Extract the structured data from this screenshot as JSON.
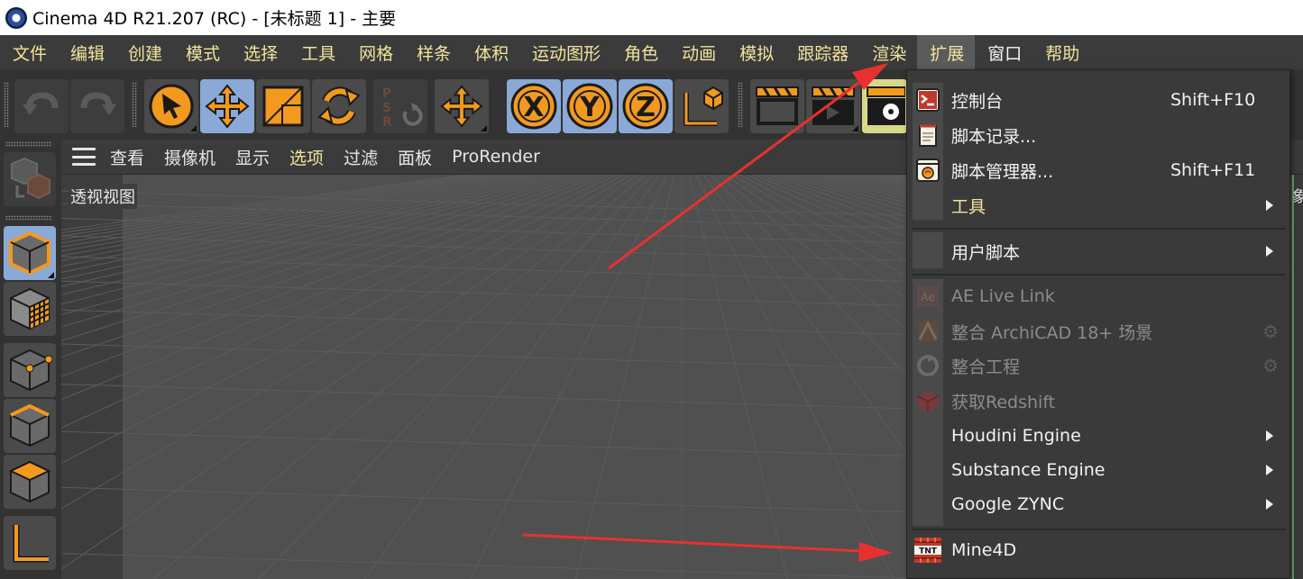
{
  "window": {
    "title": "Cinema 4D R21.207 (RC) - [未标题 1] - 主要"
  },
  "menubar": {
    "items": [
      {
        "label": "文件"
      },
      {
        "label": "编辑"
      },
      {
        "label": "创建"
      },
      {
        "label": "模式"
      },
      {
        "label": "选择"
      },
      {
        "label": "工具"
      },
      {
        "label": "网格"
      },
      {
        "label": "样条"
      },
      {
        "label": "体积"
      },
      {
        "label": "运动图形"
      },
      {
        "label": "角色"
      },
      {
        "label": "动画"
      },
      {
        "label": "模拟"
      },
      {
        "label": "跟踪器"
      },
      {
        "label": "渲染"
      },
      {
        "label": "扩展"
      },
      {
        "label": "窗口"
      },
      {
        "label": "帮助"
      }
    ],
    "active": "扩展"
  },
  "toolbar": {
    "buttons": [
      {
        "name": "undo-icon"
      },
      {
        "name": "redo-icon"
      },
      {
        "name": "live-selection-icon"
      },
      {
        "name": "move-icon"
      },
      {
        "name": "scale-icon"
      },
      {
        "name": "rotate-icon"
      },
      {
        "name": "psr-icon",
        "letters": [
          "P",
          "S",
          "R"
        ]
      },
      {
        "name": "transform-icon"
      },
      {
        "name": "x-axis-lock-icon",
        "text": "X"
      },
      {
        "name": "y-axis-lock-icon",
        "text": "Y"
      },
      {
        "name": "z-axis-lock-icon",
        "text": "Z"
      },
      {
        "name": "world-coordinates-icon"
      },
      {
        "name": "render-view-icon"
      },
      {
        "name": "render-picture-viewer-icon"
      },
      {
        "name": "render-settings-icon"
      }
    ]
  },
  "viewport_menu": {
    "items": [
      {
        "label": "查看"
      },
      {
        "label": "摄像机"
      },
      {
        "label": "显示"
      },
      {
        "label": "选项"
      },
      {
        "label": "过滤"
      },
      {
        "label": "面板"
      },
      {
        "label": "ProRender"
      }
    ],
    "highlighted": "选项"
  },
  "viewport": {
    "label": "透视视图",
    "right_edge_text": "象"
  },
  "left_palette": {
    "buttons": [
      {
        "name": "make-editable-icon"
      },
      {
        "name": "model-mode-icon"
      },
      {
        "name": "texture-mode-icon"
      },
      {
        "name": "point-mode-icon"
      },
      {
        "name": "edge-mode-icon"
      },
      {
        "name": "polygon-mode-icon"
      },
      {
        "name": "axis-mode-icon"
      }
    ]
  },
  "extensions_menu": {
    "items": [
      {
        "label": "控制台",
        "shortcut": "Shift+F10",
        "icon": "console-icon",
        "state": "normal"
      },
      {
        "label": "脚本记录...",
        "shortcut": "",
        "icon": "script-log-icon",
        "state": "normal"
      },
      {
        "label": "脚本管理器...",
        "shortcut": "Shift+F11",
        "icon": "script-manager-icon",
        "state": "normal"
      },
      {
        "label": "工具",
        "shortcut": "",
        "icon": "",
        "state": "submenu-yellow"
      },
      {
        "label": "用户脚本",
        "shortcut": "",
        "icon": "",
        "state": "submenu"
      },
      {
        "label": "AE Live Link",
        "shortcut": "",
        "icon": "ae-icon",
        "state": "disabled"
      },
      {
        "label": "整合 ArchiCAD 18+ 场景",
        "shortcut": "",
        "icon": "archicad-icon",
        "state": "disabled-gear"
      },
      {
        "label": "整合工程",
        "shortcut": "",
        "icon": "merge-project-icon",
        "state": "disabled-gear"
      },
      {
        "label": "获取Redshift",
        "shortcut": "",
        "icon": "redshift-icon",
        "state": "disabled"
      },
      {
        "label": "Houdini Engine",
        "shortcut": "",
        "icon": "",
        "state": "submenu"
      },
      {
        "label": "Substance Engine",
        "shortcut": "",
        "icon": "",
        "state": "submenu"
      },
      {
        "label": "Google ZYNC",
        "shortcut": "",
        "icon": "",
        "state": "submenu"
      },
      {
        "label": "Mine4D",
        "shortcut": "",
        "icon": "tnt-icon",
        "state": "normal",
        "icon_text": "TNT"
      }
    ]
  },
  "colors": {
    "menu_text": "#f2e39d",
    "active_menu_bg": "#5b5b5b",
    "tool_active_bg": "#8aa9d6",
    "accent_orange": "#f39a1e",
    "annotation_arrow": "#e8312f"
  }
}
